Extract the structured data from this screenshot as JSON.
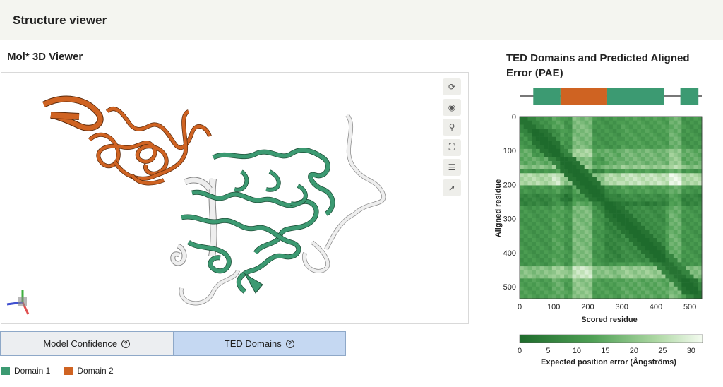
{
  "header": {
    "title": "Structure viewer"
  },
  "viewer": {
    "title": "Mol* 3D Viewer",
    "toolbar": [
      {
        "name": "reset-camera-icon",
        "glyph": "⟳"
      },
      {
        "name": "screenshot-icon",
        "glyph": "◉"
      },
      {
        "name": "wrench-icon",
        "glyph": "⚲"
      },
      {
        "name": "fullscreen-icon",
        "glyph": "⛶"
      },
      {
        "name": "settings-sliders-icon",
        "glyph": "☰"
      },
      {
        "name": "selection-cursor-icon",
        "glyph": "➚"
      }
    ]
  },
  "tabs": [
    {
      "label": "Model Confidence",
      "help": "?"
    },
    {
      "label": "TED Domains",
      "help": "?"
    }
  ],
  "legend": [
    {
      "label": "Domain 1",
      "color": "#3c9a72"
    },
    {
      "label": "Domain 2",
      "color": "#cf6322"
    }
  ],
  "pae": {
    "title": "TED Domains and Predicted Aligned Error (PAE)",
    "domains": [
      {
        "start": 40,
        "end": 120,
        "color": "#3c9a72"
      },
      {
        "start": 120,
        "end": 255,
        "color": "#cf6322"
      },
      {
        "start": 255,
        "end": 425,
        "color": "#3c9a72"
      },
      {
        "start": 472,
        "end": 525,
        "color": "#3c9a72"
      }
    ],
    "residue_count": 535,
    "x_ticks": [
      "0",
      "100",
      "200",
      "300",
      "400",
      "500"
    ],
    "y_ticks": [
      "0",
      "100",
      "200",
      "300",
      "400",
      "500"
    ],
    "xlabel": "Scored residue",
    "ylabel": "Aligned residue",
    "colorbar_ticks": [
      "0",
      "5",
      "10",
      "15",
      "20",
      "25",
      "30"
    ],
    "colorbar_label": "Expected position error (Ångströms)",
    "colorbar_max": 32
  },
  "colors": {
    "domain1": "#3c9a72",
    "domain2": "#cf6322",
    "tab_selected": "#c5d8f2",
    "unassigned": "#e4e4e4"
  }
}
